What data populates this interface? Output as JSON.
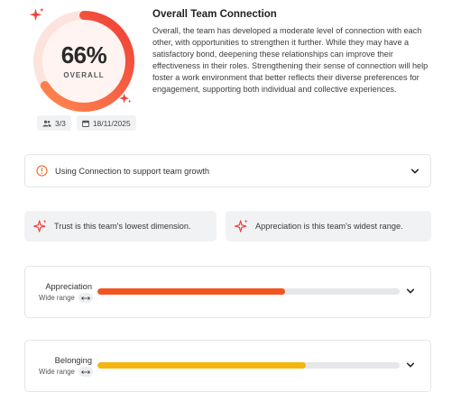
{
  "overview": {
    "percent_label": "66%",
    "percent_value": 66,
    "caption": "OVERALL",
    "members_label": "3/3",
    "date_label": "18/11/2025",
    "title": "Overall Team Connection",
    "description": "Overall, the team has developed a moderate level of connection with each other, with opportunities to strengthen it further. While they may have a satisfactory bond, deepening these relationships can improve their effectiveness in their roles. Strengthening their sense of connection will help foster a work environment that better reflects their diverse preferences for engagement, supporting both individual and collective experiences."
  },
  "accordion": {
    "label": "Using Connection to support team growth"
  },
  "insights": [
    {
      "text": "Trust is this team's lowest dimension."
    },
    {
      "text": "Appreciation is this team's widest range."
    }
  ],
  "dimensions": [
    {
      "name": "Appreciation",
      "range_label": "Wide range",
      "score_fraction": 0.62,
      "color": "#f2551f"
    },
    {
      "name": "Belonging",
      "range_label": "Wide range",
      "score_fraction": 0.69,
      "color": "#f5b50f"
    }
  ],
  "colors": {
    "accent": "#f0433a",
    "gauge_start": "#ff7a45",
    "gauge_end": "#f0433a",
    "gauge_track": "#fde6e3"
  }
}
